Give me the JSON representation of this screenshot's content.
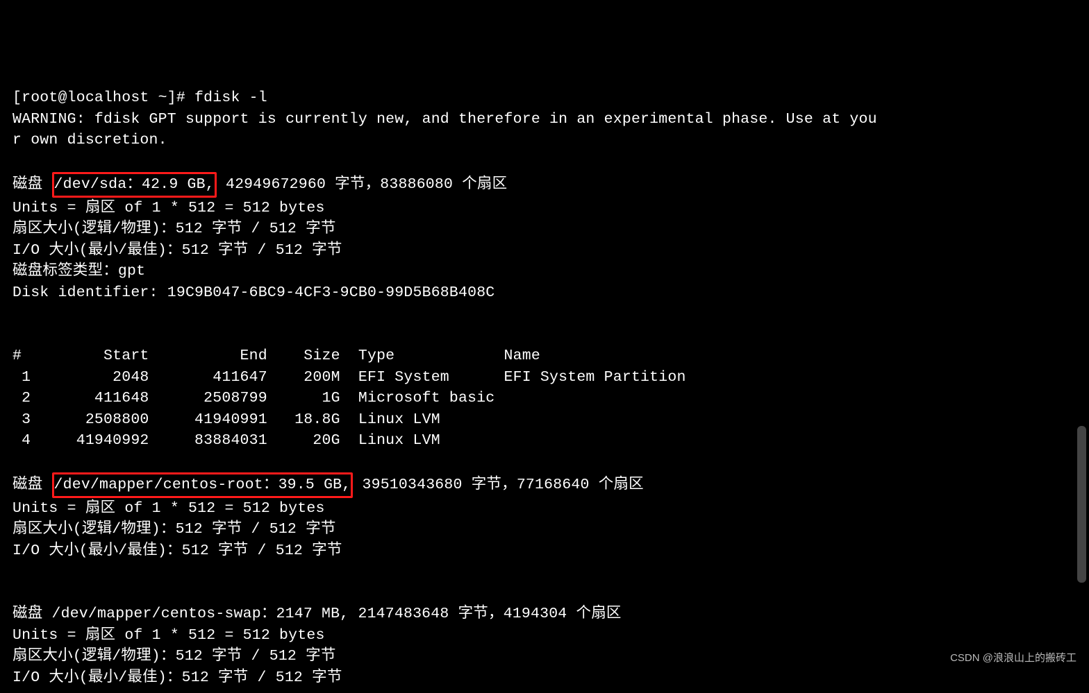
{
  "term": {
    "prompt": "[root@localhost ~]# fdisk -l",
    "warning": "WARNING: fdisk GPT support is currently new, and therefore in an experimental phase. Use at you\nr own discretion.",
    "disk1_pre": "磁盘 ",
    "disk1_hl": "/dev/sda：42.9 GB,",
    "disk1_post": " 42949672960 字节，83886080 个扇区",
    "disk1_units": "Units = 扇区 of 1 * 512 = 512 bytes",
    "disk1_sector": "扇区大小(逻辑/物理)：512 字节 / 512 字节",
    "disk1_io": "I/O 大小(最小/最佳)：512 字节 / 512 字节",
    "disk1_label": "磁盘标签类型：gpt",
    "disk1_id": "Disk identifier: 19C9B047-6BC9-4CF3-9CB0-99D5B68B408C",
    "table_hdr": "#         Start          End    Size  Type            Name",
    "table_rows": [
      " 1         2048       411647    200M  EFI System      EFI System Partition",
      " 2       411648      2508799      1G  Microsoft basic ",
      " 3      2508800     41940991   18.8G  Linux LVM       ",
      " 4     41940992     83884031     20G  Linux LVM       "
    ],
    "disk2_pre": "磁盘 ",
    "disk2_hl": "/dev/mapper/centos-root：39.5 GB,",
    "disk2_post": " 39510343680 字节，77168640 个扇区",
    "disk2_units": "Units = 扇区 of 1 * 512 = 512 bytes",
    "disk2_sector": "扇区大小(逻辑/物理)：512 字节 / 512 字节",
    "disk2_io": "I/O 大小(最小/最佳)：512 字节 / 512 字节",
    "disk3_line": "磁盘 /dev/mapper/centos-swap：2147 MB, 2147483648 字节，4194304 个扇区",
    "disk3_units": "Units = 扇区 of 1 * 512 = 512 bytes",
    "disk3_sector": "扇区大小(逻辑/物理)：512 字节 / 512 字节",
    "disk3_io": "I/O 大小(最小/最佳)：512 字节 / 512 字节"
  },
  "watermark": "CSDN @浪浪山上的搬砖工"
}
